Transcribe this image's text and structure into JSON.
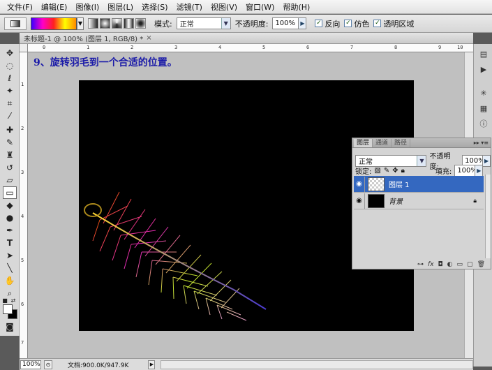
{
  "menu": [
    "文件(F)",
    "编辑(E)",
    "图像(I)",
    "图层(L)",
    "选择(S)",
    "滤镜(T)",
    "视图(V)",
    "窗口(W)",
    "帮助(H)"
  ],
  "options": {
    "mode_label": "模式:",
    "mode_value": "正常",
    "opacity_label": "不透明度:",
    "opacity_value": "100%",
    "reverse_label": "反向",
    "dither_label": "仿色",
    "transparency_label": "透明区域"
  },
  "document": {
    "tab_title": "未标题-1 @ 100% (图层 1, RGB/8) *",
    "tab_close": "×",
    "instruction": "9、旋转羽毛到一个合适的位置。",
    "ruler_h": [
      "0",
      "1",
      "2",
      "3",
      "4",
      "5",
      "6",
      "7",
      "8",
      "9",
      "10"
    ],
    "ruler_v": [
      "1",
      "2",
      "3",
      "4",
      "5",
      "6",
      "7"
    ]
  },
  "status": {
    "zoom": "100%",
    "doc_size": "文档:900.0K/947.9K"
  },
  "layers_panel": {
    "tabs": [
      "图层",
      "通道",
      "路径"
    ],
    "blend_mode": "正常",
    "opacity_label": "不透明度:",
    "opacity_value": "100%",
    "lock_label": "锁定:",
    "fill_label": "填充:",
    "fill_value": "100%",
    "layers": [
      {
        "name": "图层 1",
        "selected": true
      },
      {
        "name": "背景",
        "selected": false
      }
    ]
  },
  "colors": {
    "instruction": "#1a1aa8",
    "selected_layer": "#3468c0",
    "canvas": "#000000"
  }
}
